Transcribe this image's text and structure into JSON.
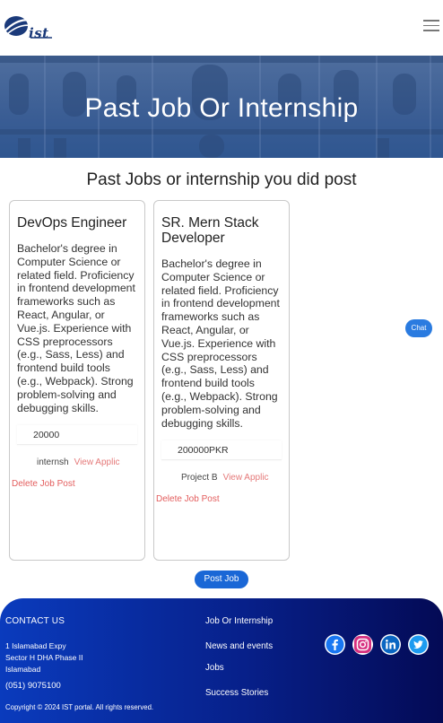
{
  "header": {
    "logo_text": "ist",
    "menu_icon": "hamburger-menu-icon"
  },
  "hero": {
    "title": "Past Job Or Internship"
  },
  "section": {
    "title": "Past Jobs or internship you did post"
  },
  "jobs": [
    {
      "title": "DevOps Engineer",
      "description": "Bachelor's degree in Computer Science or related field. Proficiency in frontend development frameworks such as React, Angular, or Vue.js. Experience with CSS preprocessors (e.g., Sass, Less) and frontend build tools (e.g., Webpack). Strong problem-solving and debugging skills.",
      "salary": "20000",
      "type": "internsh",
      "view_link": "View Applic",
      "delete_link": "Delete Job Post"
    },
    {
      "title": "SR. Mern Stack Developer",
      "description": "Bachelor's degree in Computer Science or related field. Proficiency in frontend development frameworks such as React, Angular, or Vue.js. Experience with CSS preprocessors (e.g., Sass, Less) and frontend build tools (e.g., Webpack). Strong problem-solving and debugging skills.",
      "salary": "200000PKR",
      "type": "Project B",
      "view_link": "View Applic",
      "delete_link": "Delete Job Post"
    }
  ],
  "actions": {
    "post_job": "Post Job",
    "chat": "Chat"
  },
  "footer": {
    "contact_heading": "CONTACT US",
    "address_line1": "1 Islamabad Expy",
    "address_line2": "Sector H DHA Phase II",
    "address_line3": "Islamabad",
    "phone": "(051) 9075100",
    "copyright": "Copyright © 2024 IST portal. All rights reserved.",
    "links": [
      "Job Or Internship",
      "News and events",
      "Jobs",
      "Success Stories"
    ],
    "socials": [
      "facebook-icon",
      "instagram-icon",
      "linkedin-icon",
      "twitter-icon"
    ]
  },
  "colors": {
    "primary": "#1a67d6",
    "delete": "#e35d5d",
    "footer_start": "#0a3bbd",
    "footer_end": "#040a55"
  }
}
